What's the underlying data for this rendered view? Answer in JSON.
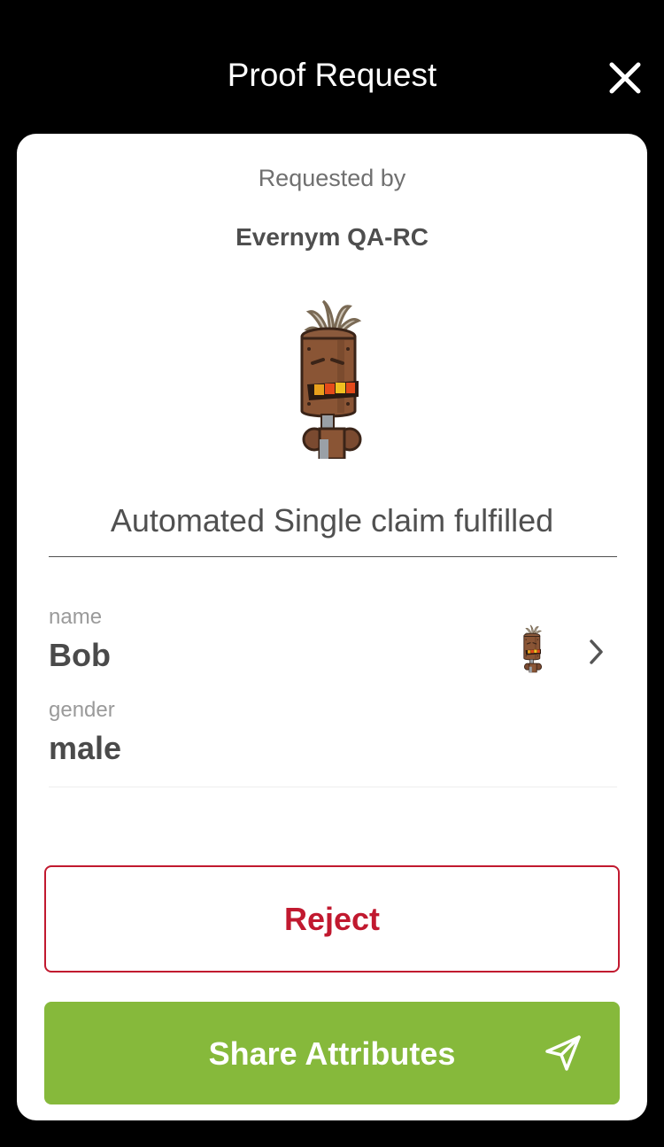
{
  "header": {
    "title": "Proof Request",
    "close_icon": "close-icon"
  },
  "card": {
    "requested_by_label": "Requested by",
    "org_name": "Evernym QA-RC",
    "org_logo": "robot-avatar-logo",
    "request_title": "Automated Single claim fulfilled"
  },
  "attributes": [
    {
      "label": "name",
      "value": "Bob"
    },
    {
      "label": "gender",
      "value": "male"
    }
  ],
  "attribute_source": {
    "logo": "robot-avatar-logo",
    "chevron": "chevron-right-icon"
  },
  "actions": {
    "reject_label": "Reject",
    "share_label": "Share Attributes",
    "share_icon": "send-icon"
  },
  "colors": {
    "background": "#000000",
    "card": "#ffffff",
    "reject": "#c1192f",
    "share": "#86b93b"
  }
}
